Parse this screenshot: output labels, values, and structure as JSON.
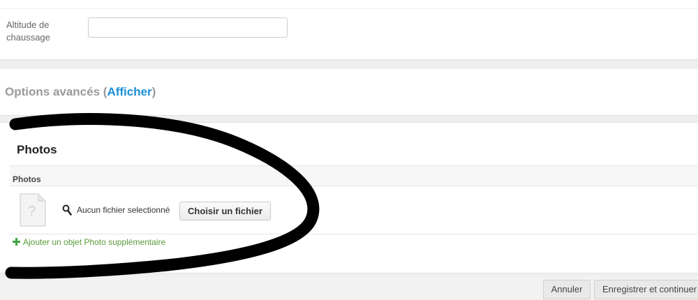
{
  "top_section": {
    "field_label": "Altitude de chaussage",
    "field_value": ""
  },
  "options": {
    "title_prefix": "Options avancés (",
    "toggle_link": "Afficher",
    "title_suffix": ")"
  },
  "photos": {
    "section_title": "Photos",
    "column_header": "Photos",
    "file_status": "Aucun fichier selectionné",
    "choose_file_label": "Choisir un fichier",
    "add_more_label": "Ajouter un objet Photo supplémentaire"
  },
  "footer": {
    "cancel_label": "Annuler",
    "save_continue_label": "Enregistrer et continuer"
  },
  "colors": {
    "link_blue": "#1a8fd8",
    "add_green": "#5a9a3a",
    "marker": "#000000"
  },
  "icons": [
    "magnifier-icon",
    "file-placeholder-icon",
    "plus-icon"
  ]
}
